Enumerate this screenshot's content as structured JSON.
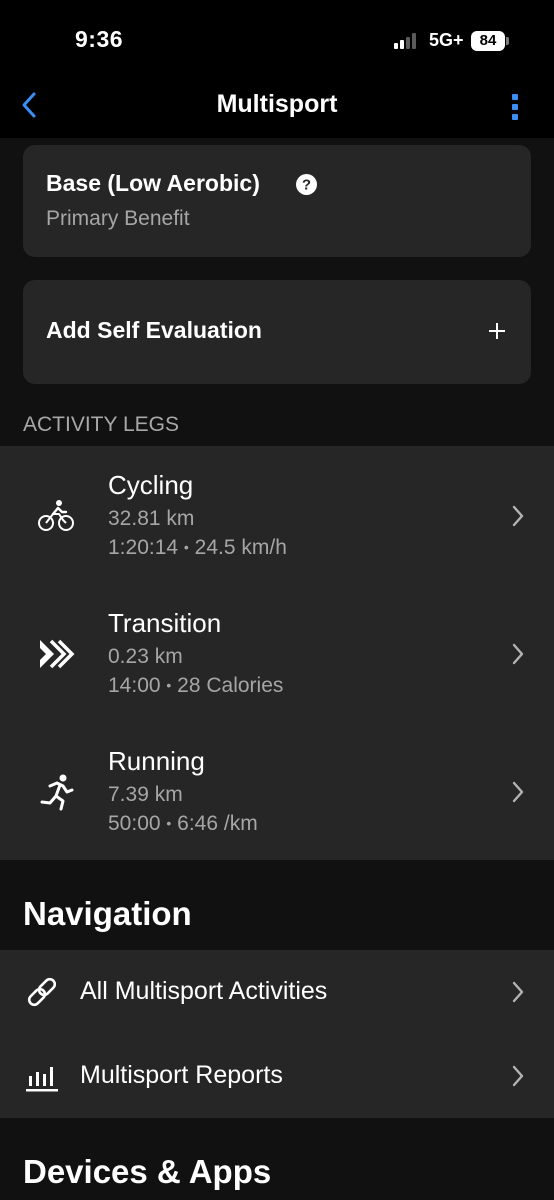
{
  "status_bar": {
    "time": "9:36",
    "network": "5G+",
    "battery": "84"
  },
  "header": {
    "title": "Multisport",
    "back_icon": "chevron-left-icon",
    "more_icon": "vertical-dots-icon",
    "accent_color": "#3a8ef6"
  },
  "benefit": {
    "title": "Base (Low Aerobic)",
    "subtitle": "Primary Benefit",
    "help_icon": "question-circle-icon"
  },
  "self_evaluation": {
    "label": "Add Self Evaluation",
    "icon": "plus-icon"
  },
  "activity_legs": {
    "section_label": "ACTIVITY LEGS",
    "legs": [
      {
        "name": "Cycling",
        "distance": "32.81 km",
        "duration": "1:20:14",
        "separator": "•",
        "metric": "24.5 km/h",
        "icon": "cycling-icon"
      },
      {
        "name": "Transition",
        "distance": "0.23 km",
        "duration": "14:00",
        "separator": "•",
        "metric": "28 Calories",
        "icon": "transition-arrows-icon"
      },
      {
        "name": "Running",
        "distance": "7.39 km",
        "duration": "50:00",
        "separator": "•",
        "metric": "6:46 /km",
        "icon": "running-icon"
      }
    ]
  },
  "navigation": {
    "heading": "Navigation",
    "items": [
      {
        "label": "All Multisport Activities",
        "icon": "link-icon"
      },
      {
        "label": "Multisport Reports",
        "icon": "bar-chart-icon"
      }
    ]
  },
  "devices": {
    "heading": "Devices & Apps"
  }
}
